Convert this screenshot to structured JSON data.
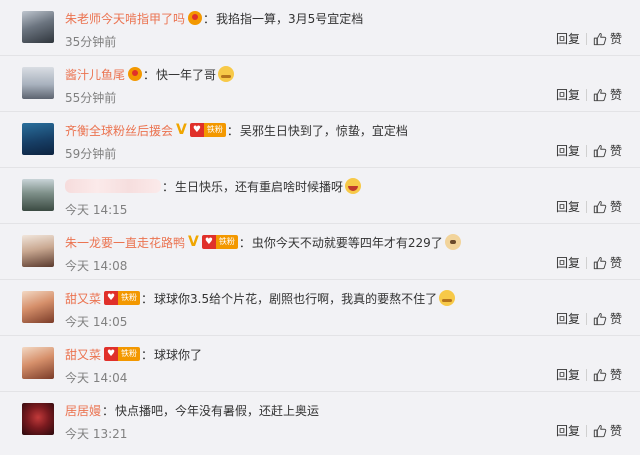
{
  "actions": {
    "reply": "回复",
    "like": "赞"
  },
  "comments": [
    {
      "name": "朱老师今天啃指甲了吗",
      "text": "我掐指一算，3月5号宜定档",
      "time": "35分钟前"
    },
    {
      "name": "酱汁儿鱼尾",
      "text": "快一年了哥",
      "time": "55分钟前"
    },
    {
      "name": "齐衡全球粉丝后援会",
      "badge": "铁粉",
      "text": "吴邪生日快到了，惊蛰，宜定档",
      "time": "59分钟前"
    },
    {
      "name": "",
      "text": "生日快乐，还有重启啥时候播呀",
      "time": "今天 14:15"
    },
    {
      "name": "朱一龙要一直走花路鸭",
      "badge": "铁粉",
      "text": "虫你今天不动就要等四年才有229了",
      "time": "今天 14:08"
    },
    {
      "name": "甜又菜",
      "badge": "铁粉",
      "text": "球球你3.5给个片花，剧照也行啊，我真的要熬不住了",
      "time": "今天 14:05"
    },
    {
      "name": "甜又菜",
      "badge": "铁粉",
      "text": "球球你了",
      "time": "今天 14:04"
    },
    {
      "name": "居居嫚",
      "text": "快点播吧，今年没有暑假，还赶上奥运",
      "time": "今天 13:21"
    }
  ]
}
